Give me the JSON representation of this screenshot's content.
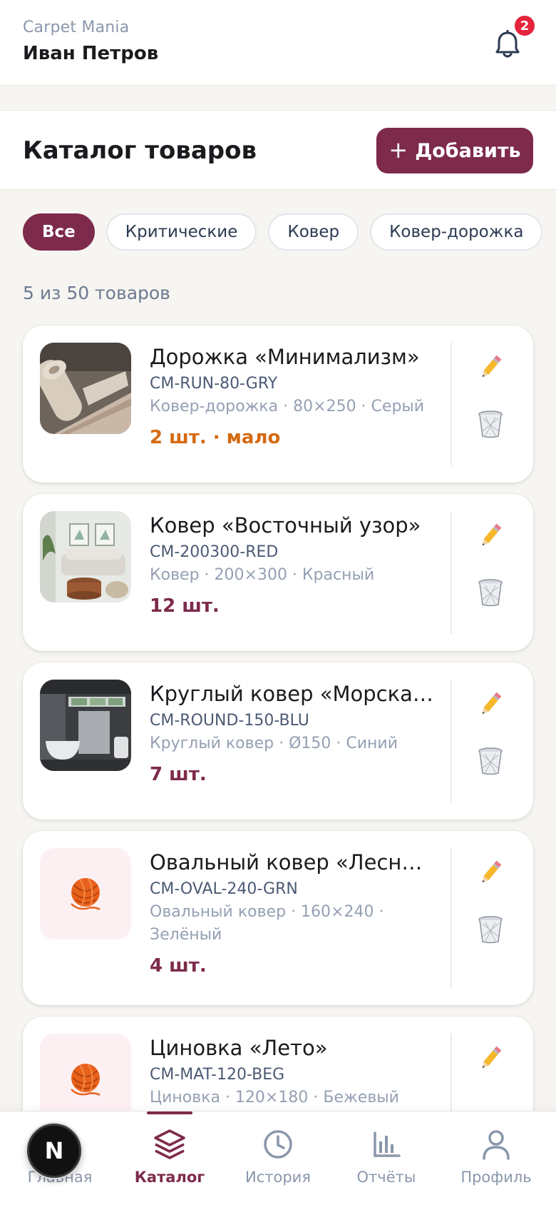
{
  "header": {
    "brand": "Carpet Mania",
    "user_name": "Иван Петров",
    "notifications_count": "2"
  },
  "catalog": {
    "title": "Каталог товаров",
    "add_label": "Добавить",
    "count_text": "5 из 50 товаров"
  },
  "filters": [
    {
      "label": "Все",
      "active": true
    },
    {
      "label": "Критические",
      "active": false
    },
    {
      "label": "Ковер",
      "active": false
    },
    {
      "label": "Ковер-дорожка",
      "active": false
    }
  ],
  "products": [
    {
      "name": "Дорожка «Минимализм»",
      "sku": "CM-RUN-80-GRY",
      "meta": "Ковер-дорожка · 80×250 · Серый",
      "stock": "2 шт. · мало",
      "low": true,
      "image": "runner-rug-photo"
    },
    {
      "name": "Ковер «Восточный узор»",
      "sku": "CM-200300-RED",
      "meta": "Ковер · 200×300 · Красный",
      "stock": "12 шт.",
      "low": false,
      "image": "living-room-photo"
    },
    {
      "name": "Круглый ковер «Морская волна»",
      "sku": "CM-ROUND-150-BLU",
      "meta": "Круглый ковер · Ø150 · Синий",
      "stock": "7 шт.",
      "low": false,
      "image": "bathroom-photo"
    },
    {
      "name": "Овальный ковер «Лесная поляна»",
      "sku": "CM-OVAL-240-GRN",
      "meta": "Овальный ковер · 160×240 · Зелёный",
      "stock": "4 шт.",
      "low": false,
      "image": "yarn-ball-icon"
    },
    {
      "name": "Циновка «Лето»",
      "sku": "CM-MAT-120-BEG",
      "meta": "Циновка · 120×180 · Бежевый",
      "stock": "",
      "low": false,
      "image": "yarn-ball-icon"
    }
  ],
  "nav": {
    "home": "Главная",
    "catalog": "Каталог",
    "history": "История",
    "reports": "Отчёты",
    "profile": "Профиль"
  },
  "fab_label": "N",
  "colors": {
    "accent": "#7d2a4b",
    "low_stock": "#d56a12",
    "badge": "#e5243b"
  }
}
